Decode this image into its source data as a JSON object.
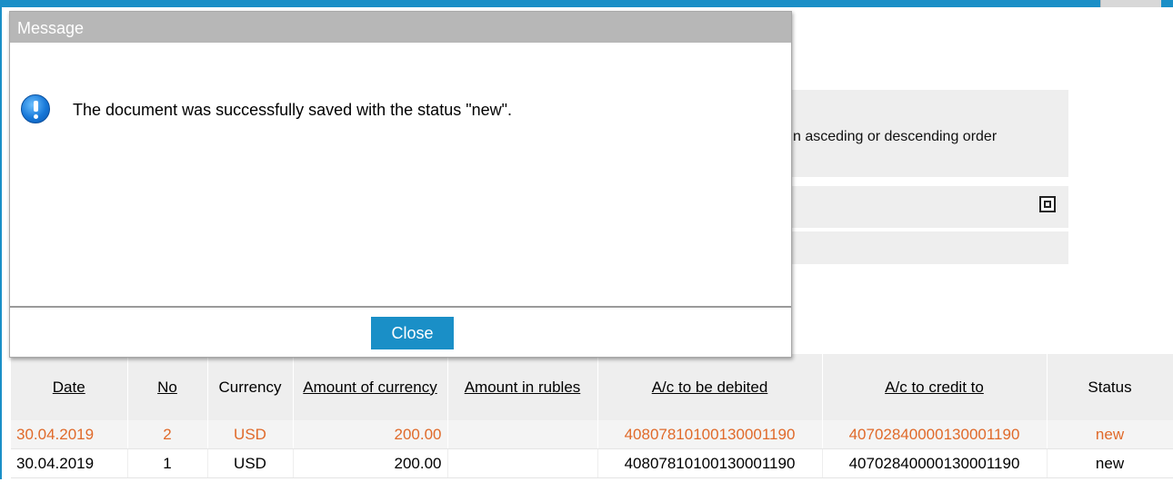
{
  "background": {
    "info_panel_text": "n asceding or descending order",
    "maximize_icon": "maximize-icon"
  },
  "grid": {
    "columns": [
      "Date",
      "No",
      "Currency",
      "Amount of currency",
      "Amount in rubles",
      "A/c to be debited",
      "A/c to credit to",
      "Status"
    ],
    "rows": [
      {
        "date": "30.04.2019",
        "no": "2",
        "currency": "USD",
        "amount_currency": "200.00",
        "amount_rubles": "",
        "debit": "40807810100130001190",
        "credit": "40702840000130001190",
        "status": "new"
      },
      {
        "date": "30.04.2019",
        "no": "1",
        "currency": "USD",
        "amount_currency": "200.00",
        "amount_rubles": "",
        "debit": "40807810100130001190",
        "credit": "40702840000130001190",
        "status": "new"
      }
    ],
    "selected_row_color": "#e06a2a"
  },
  "modal": {
    "title": "Message",
    "icon": "info-icon",
    "message": "The document was successfully saved with the status \"new\".",
    "close_label": "Close"
  },
  "colors": {
    "accent": "#1a8fc7",
    "titlebar": "#b7b7b7",
    "panel": "#eeeeee"
  }
}
